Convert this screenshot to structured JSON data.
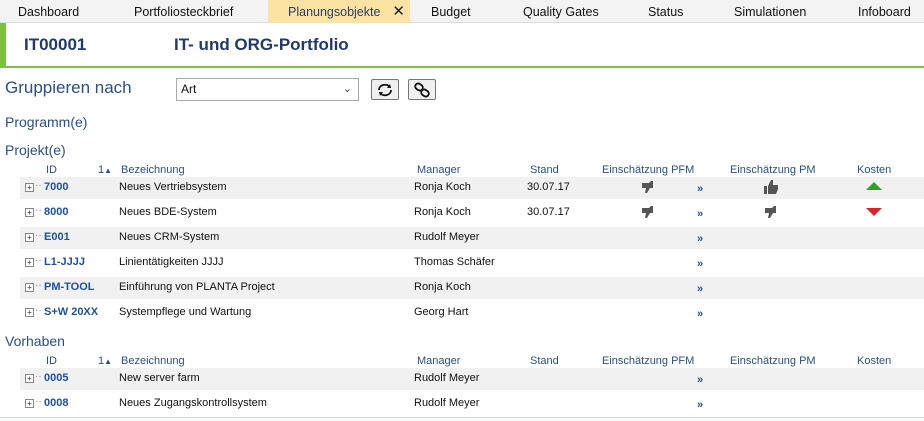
{
  "tabs": [
    {
      "label": "Dashboard"
    },
    {
      "label": "Portfoliosteckbrief"
    },
    {
      "label": "Planungsobjekte"
    },
    {
      "label": "Budget"
    },
    {
      "label": "Quality Gates"
    },
    {
      "label": "Status"
    },
    {
      "label": "Simulationen"
    },
    {
      "label": "Infoboard"
    }
  ],
  "tab_close": "✕",
  "header": {
    "id": "IT00001",
    "title": "IT- und ORG-Portfolio"
  },
  "grouping": {
    "label": "Gruppieren nach",
    "selected": "Art"
  },
  "sections": {
    "programme": "Programm(e)",
    "projects": "Projekt(e)",
    "vorhaben": "Vorhaben"
  },
  "columns": {
    "id": "ID",
    "sort_index": "1",
    "bezeichnung": "Bezeichnung",
    "manager": "Manager",
    "stand": "Stand",
    "pfm": "Einschätzung PFM",
    "pm": "Einschätzung PM",
    "kosten": "Kosten"
  },
  "link_glyph": "»",
  "projects": [
    {
      "id": "7000",
      "bezeichnung": "Neues Vertriebsystem",
      "manager": "Ronja Koch",
      "stand": "30.07.17",
      "pfm": "thumb-sideways-icon",
      "pm": "thumb-up-icon",
      "kosten": "up"
    },
    {
      "id": "8000",
      "bezeichnung": "Neues BDE-System",
      "manager": "Ronja Koch",
      "stand": "30.07.17",
      "pfm": "thumb-sideways-icon",
      "pm": "thumb-sideways-icon",
      "kosten": "down"
    },
    {
      "id": "E001",
      "bezeichnung": "Neues CRM-System",
      "manager": "Rudolf Meyer",
      "stand": "",
      "pfm": "",
      "pm": "",
      "kosten": ""
    },
    {
      "id": "L1-JJJJ",
      "bezeichnung": "Linientätigkeiten JJJJ",
      "manager": "Thomas Schäfer",
      "stand": "",
      "pfm": "",
      "pm": "",
      "kosten": ""
    },
    {
      "id": "PM-TOOL",
      "bezeichnung": "Einführung von PLANTA Project",
      "manager": "Ronja Koch",
      "stand": "",
      "pfm": "",
      "pm": "",
      "kosten": ""
    },
    {
      "id": "S+W 20XX",
      "bezeichnung": "Systempflege und Wartung",
      "manager": "Georg Hart",
      "stand": "",
      "pfm": "",
      "pm": "",
      "kosten": ""
    }
  ],
  "vorhaben": [
    {
      "id": "0005",
      "bezeichnung": "New server farm",
      "manager": "Rudolf Meyer"
    },
    {
      "id": "0008",
      "bezeichnung": "Neues Zugangskontrollsystem",
      "manager": "Rudolf Meyer"
    }
  ],
  "colors": {
    "accent_green": "#7cc242",
    "cost_up": "#2ea02e",
    "cost_down": "#d4272b",
    "active_tab": "#fbe3a3"
  }
}
